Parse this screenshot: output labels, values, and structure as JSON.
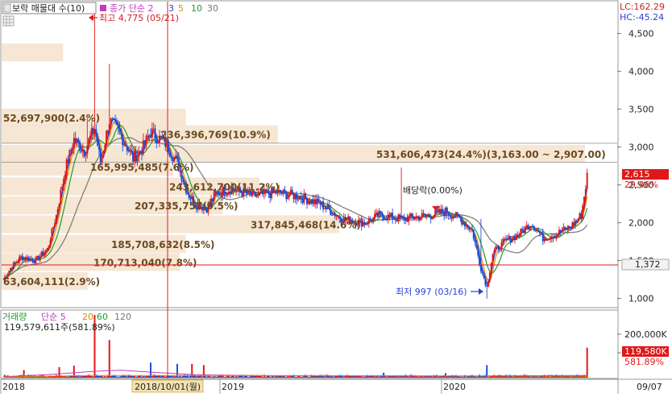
{
  "legend": {
    "title": "보락 매물대 수(10)",
    "ma_label": "종가 단순 2",
    "ma_periods": [
      "3",
      "5",
      "10",
      "30"
    ],
    "ma_colors": [
      "#2a3fd6",
      "#e08a00",
      "#1f9a2e",
      "#777777"
    ]
  },
  "top_right": {
    "lc": "LC:162.29",
    "hc": "HC:-45.24"
  },
  "volume_legend": {
    "title": "거래량",
    "ma_label": "단순 5",
    "periods": [
      "20",
      "60",
      "120"
    ],
    "period_colors": [
      "#e08a00",
      "#1f9a2e",
      "#777777"
    ],
    "current": "119,579,611주(581.89%)"
  },
  "x_axis": {
    "labels": [
      "2018",
      "2019",
      "2020",
      "09/07"
    ],
    "cursor_label": "2018/10/01(월)"
  },
  "price_axis": {
    "ticks": [
      "4,500",
      "4,000",
      "3,500",
      "3,000",
      "2,500",
      "2,000",
      "1,500",
      "1,000"
    ]
  },
  "volume_axis": {
    "ticks": [
      "200,000K",
      "100,000K"
    ]
  },
  "right_labels": {
    "price_box": "2,615",
    "price_pct": "29.46%",
    "cursor_price_box": "1,372",
    "volume_box": "119,580K",
    "volume_pct": "581.89%"
  },
  "annotations": {
    "high": "최고 4,775 (05/21)",
    "low": "최저 997 (03/16)",
    "ex_dividend": "배당락(0.00%)"
  },
  "chart_data": {
    "type": "candlestick",
    "price_range": [
      900,
      4900
    ],
    "volume_range": [
      0,
      260000
    ],
    "last_price": 2615,
    "last_volume_k": 119580,
    "high": {
      "value": 4775,
      "date": "05/21"
    },
    "low": {
      "value": 997,
      "date": "03/16"
    },
    "volume_profile": [
      {
        "price": 4250,
        "label": ""
      },
      {
        "price": 3390,
        "label": "52,697,900(2.4%)"
      },
      {
        "price": 3170,
        "label": "236,396,769(10.9%)"
      },
      {
        "price": 2910,
        "label": "531,606,473(24.4%)(3,163.00 ~ 2,907.00)"
      },
      {
        "price": 2740,
        "label": "165,995,485(7.6%)"
      },
      {
        "price": 2480,
        "label": "243,612,700(11.2%)"
      },
      {
        "price": 2230,
        "label": "207,335,757(9.5%)"
      },
      {
        "price": 1980,
        "label": "317,845,468(14.6%)"
      },
      {
        "price": 1720,
        "label": "185,708,632(8.5%)"
      },
      {
        "price": 1480,
        "label": "170,713,040(7.8%)"
      },
      {
        "price": 1230,
        "label": "63,604,111(2.9%)"
      }
    ],
    "price_path": [
      [
        0,
        1250
      ],
      [
        5,
        1400
      ],
      [
        12,
        1550
      ],
      [
        22,
        1500
      ],
      [
        30,
        1650
      ],
      [
        36,
        2100
      ],
      [
        42,
        2700
      ],
      [
        48,
        3100
      ],
      [
        55,
        2950
      ],
      [
        62,
        3250
      ],
      [
        66,
        2800
      ],
      [
        72,
        3350
      ],
      [
        80,
        3150
      ],
      [
        88,
        2850
      ],
      [
        95,
        3000
      ],
      [
        100,
        3200
      ],
      [
        110,
        3050
      ],
      [
        118,
        2800
      ],
      [
        125,
        2400
      ],
      [
        130,
        2250
      ],
      [
        138,
        2200
      ],
      [
        145,
        2400
      ],
      [
        155,
        2450
      ],
      [
        170,
        2350
      ],
      [
        185,
        2400
      ],
      [
        200,
        2350
      ],
      [
        215,
        2250
      ],
      [
        230,
        2050
      ],
      [
        245,
        2000
      ],
      [
        255,
        2100
      ],
      [
        270,
        2050
      ],
      [
        290,
        2100
      ],
      [
        300,
        2150
      ],
      [
        310,
        2050
      ],
      [
        318,
        1900
      ],
      [
        324,
        1400
      ],
      [
        328,
        1150
      ],
      [
        332,
        1600
      ],
      [
        340,
        1750
      ],
      [
        350,
        1850
      ],
      [
        358,
        2000
      ],
      [
        366,
        1800
      ],
      [
        375,
        1850
      ],
      [
        385,
        1950
      ],
      [
        392,
        2100
      ],
      [
        396,
        2615
      ]
    ],
    "series": [
      {
        "name": "3",
        "values": []
      },
      {
        "name": "5",
        "values": []
      },
      {
        "name": "10",
        "values": []
      },
      {
        "name": "30",
        "values": []
      }
    ]
  }
}
